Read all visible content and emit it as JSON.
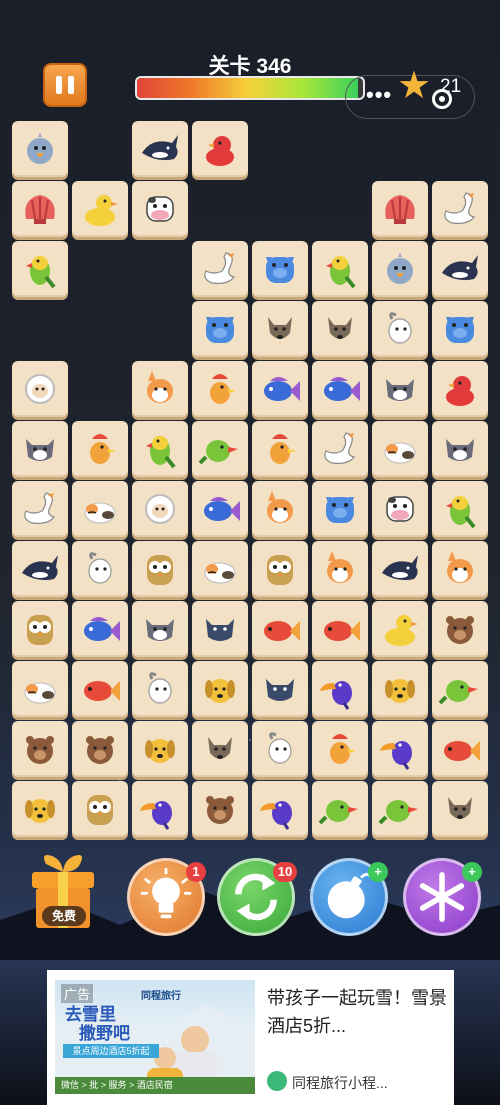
{
  "header": {
    "level_title": "关卡 346",
    "progress_fraction": 0.98,
    "star_count": "21",
    "menu_dots": "•••"
  },
  "tile_grid": [
    [
      "chick-blue",
      null,
      "orca",
      "duck-red",
      null,
      null,
      null,
      null
    ],
    [
      "shell",
      "duck-yellow",
      "cow",
      null,
      null,
      null,
      "shell",
      "swan"
    ],
    [
      "parrot",
      null,
      null,
      "swan",
      "pig",
      "parrot",
      "chick-blue",
      "orca"
    ],
    [
      null,
      null,
      null,
      "pig",
      "dog-gray",
      "dog-gray",
      "goat",
      "pig"
    ],
    [
      "sheep",
      null,
      "corgi",
      "rooster",
      "fish-blue",
      "fish-blue",
      "cat",
      "duck-red"
    ],
    [
      "cat",
      "rooster",
      "parrot",
      "bird-green",
      "rooster",
      "swan",
      "calico",
      "cat"
    ],
    [
      "swan",
      "calico",
      "sheep",
      "fish-blue",
      "corgi",
      "pig",
      "cow",
      "parrot"
    ],
    [
      "orca",
      "goat",
      "owl",
      "calico",
      "owl",
      "corgi",
      "orca",
      "corgi"
    ],
    [
      "owl",
      "fish-blue",
      "cat",
      "cat-dark",
      "fish-red",
      "fish-red",
      "duck-yellow",
      "bear"
    ],
    [
      "calico",
      "fish-red",
      "goat",
      "dog-yellow",
      "cat-dark",
      "toucan",
      "dog-yellow",
      "bird-green"
    ],
    [
      "bear",
      "bear",
      "dog-yellow",
      "dog-gray",
      "goat",
      "rooster",
      "toucan",
      "fish-red"
    ],
    [
      "dog-yellow",
      "owl",
      "toucan",
      "bear",
      "toucan",
      "bird-green",
      "bird-green",
      "dog-gray"
    ]
  ],
  "tools": {
    "gift_label": "免费",
    "hint_badge": "1",
    "shuffle_badge": "10",
    "bomb_badge": "+",
    "freeze_badge": "+"
  },
  "ad": {
    "tag": "广告",
    "brand": "同程旅行",
    "slogan_line1": "去雪里",
    "slogan_line2": "撒野吧",
    "sub": "景点周边酒店5折起",
    "bottom_bar": "微信 > 批 > 服务 > 酒店民宿",
    "title": "带孩子一起玩雪！雪景酒店5折...",
    "source": "同程旅行小程..."
  },
  "colors": {
    "tile": "#f2e1c4",
    "pause": "#e88a2a",
    "hint": "#e8914a",
    "shuffle": "#4cb84a",
    "bomb": "#3a8ad8",
    "freeze": "#9a5ad0",
    "star": "#f3b43a"
  }
}
